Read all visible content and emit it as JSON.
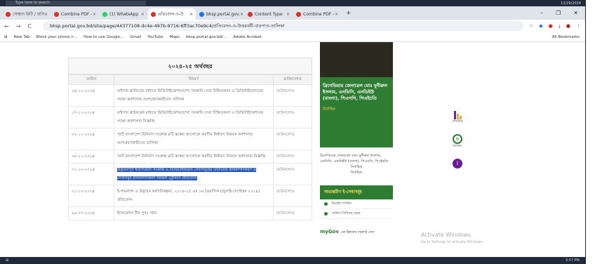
{
  "os": {
    "search_placeholder": "Type here to search",
    "date": "12/29/2024",
    "time": "3:57 PM"
  },
  "browser": {
    "tabs": [
      {
        "label": "সোহাগ রিটি / বাণি",
        "fav_color": "#d93025",
        "active": false
      },
      {
        "label": "Combine PDF -",
        "fav_color": "#d93025",
        "active": false
      },
      {
        "label": "(1) WhatsApp",
        "fav_color": "#25d366",
        "active": false
      },
      {
        "label": "প্রতিবেদন-ও-উ",
        "fav_color": "#d93025",
        "active": true
      },
      {
        "label": "bksp.portal.gov.",
        "fav_color": "#1a73e8",
        "active": false
      },
      {
        "label": "Content Type",
        "fav_color": "#d93025",
        "active": false
      },
      {
        "label": "Combine PDF -",
        "fav_color": "#d93025",
        "active": false
      }
    ],
    "new_tab_label": "+",
    "url": "bksp.portal.gov.bd/site/page/44377108-dc4e-497b-9716-6ff3ac70e9c4/প্রতিবেদন-ও-উত্তরবর্ষী-বারপাত-তালিকা",
    "bookmarks": [
      "New Tab",
      "Block your phone n...",
      "How to use Google...",
      "Gmail",
      "YouTube",
      "Maps",
      "bksp.portal.gov.bd/...",
      "Adobe Acrobat"
    ],
    "all_bookmarks": "All Bookmarks"
  },
  "table": {
    "year_heading": "২০২৪-২৫ অর্থবছর",
    "headers": [
      "তারিখ",
      "বিবরণ",
      "ডাউনলোড"
    ],
    "rows": [
      {
        "date": "২৪-১২-২০২৪",
        "desc": "মাইপার প্লাটফর্মের মাধ্যমে ডিজিটাইজেশনযোগ্য সরকারি সেবা চিহ্নিতকরণ ও ডিজিটাইজেশনের লক্ষ্যে কর্মশালায় অংশগ্রহণকারীদের তালিকা",
        "dl": "ডাউনলোড",
        "hl": false
      },
      {
        "date": "১৭-১২-২০২৪",
        "desc": "মাইপার প্লাটফর্মের মাধ্যমে ডিজিটাইজেশনযোগ্য সরকারি সেবা চিহ্নিতকরণ ও ডিজিটাইজেশনের লক্ষ্যে কর্মশালার বিজ্ঞপ্তি",
        "dl": "ডাউনলোড",
        "hl": false
      },
      {
        "date": "০২-১২-২০২৪",
        "desc": "স্মার্ট বাংলাদেশ বিনির্মাণ সংক্রান্ত ৪টি স্তম্ভের আলোকে করণীয় নির্ধারণ বিষয়ক কর্মশালায় অংশগ্রহণকারীদের তালিকা",
        "dl": "ডাউনলোড",
        "hl": false
      },
      {
        "date": "২৮-১১-২০২৪",
        "desc": "স্মার্ট বাংলাদেশ বিনির্মাণ সংক্রান্ত ৪টি স্তম্ভের আলোকে করণীয় নির্ধারণ বিষয়ক কর্মশালার বিজ্ঞপ্তি",
        "dl": "ডাউনলোড",
        "hl": false
      },
      {
        "date": "০১-১০-২০২৪",
        "desc": "উদ্ভাবনপূর্ণ ধারণাগুলি সংক্রান্ত ও ডিজিটাইজকৃত সেবাসমূহের ডাটাবেজ হালনাগাদকরণ ও সেবাসমূহ হালনাগাদকরণ বিষয়ক ট্রেনিংস প্রতিবেদন",
        "dl": "ডাউনলোড",
        "hl": true
      },
      {
        "date": "০১-১০-২০২৪",
        "desc": "ই-গভর্ন্যান্স ও উদ্ভাবন কর্মপরিকল্পনা, ২০২৪-২৫ এর ১ম ত্রৈমাসিক (জুলাই-সেপ্টেম্বর ২০২৪) প্রতিবেদন",
        "dl": "ডাউনলোড",
        "hl": false
      },
      {
        "date": "২৯-০৭-২০২৪",
        "desc": "ইনোভেশন টীম পুনঃ গঠন",
        "dl": "ডাউনলোড",
        "hl": false
      }
    ]
  },
  "sidebar": {
    "officer_name": "ব্রিগেডিয়ার জেনারেল মোঃ মুনীরুল ইসলাম, এনডিসি, এনডিইউ (বাংলা), পিএসসি, পিএইচডি",
    "officer_title": "নির্বাহিক",
    "image_caption": "ব্রিগেডিয়ার জেনারেল মোঃ মুনীরুল ইসলাম, এনডিসি, এনডিইউ (বাংলা), পিএসসি, পিএইচডি",
    "caption_role": "নির্বাহিক",
    "caption_role2": "নির্বাহিক",
    "services_heading": "অভ্যন্তরীণ ই-সেবাসমূহ",
    "services": [
      "ইমেইল লগইন",
      "সার্ভিস বিধিবদ্ধ ফরম"
    ],
    "mygov_label": "myGov",
    "mygov_sub": "এক ঠিকানায় সরকারি সেবা"
  },
  "widgets": {
    "stats_label": "লেখচিত্র",
    "feedback_label": "মতামত",
    "info_label": "i"
  },
  "watermark": {
    "title": "Activate Windows",
    "sub": "Go to Settings to activate Windows."
  }
}
